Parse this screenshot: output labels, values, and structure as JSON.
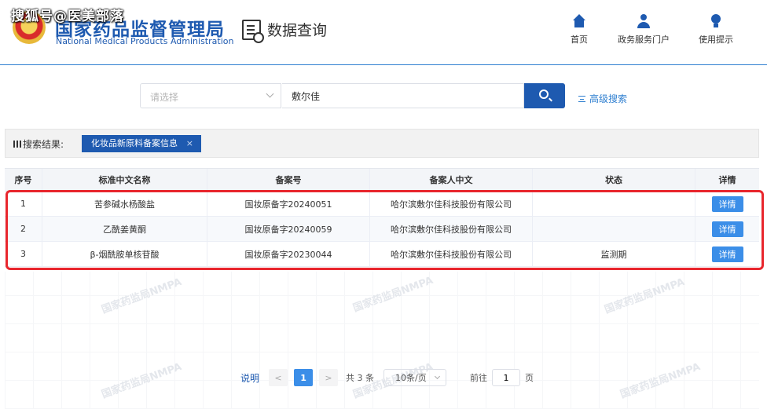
{
  "overlay_watermark": "搜狐号@医美部落",
  "header": {
    "org_name_cn": "国家药品监督管理局",
    "org_name_en": "National Medical Products Administration",
    "section_title": "数据查询",
    "nav": [
      {
        "label": "首页",
        "icon": "home-icon"
      },
      {
        "label": "政务服务门户",
        "icon": "user-icon"
      },
      {
        "label": "使用提示",
        "icon": "lightbulb-icon"
      }
    ]
  },
  "search": {
    "category_placeholder": "请选择",
    "query_value": "敷尔佳",
    "advanced_label": "高级搜索"
  },
  "results": {
    "label": "搜索结果:",
    "active_tag": "化妆品新原料备案信息",
    "close_glyph": "×"
  },
  "table": {
    "columns": [
      "序号",
      "标准中文名称",
      "备案号",
      "备案人中文",
      "状态",
      "详情"
    ],
    "rows": [
      {
        "no": "1",
        "name": "苦参碱水杨酸盐",
        "record": "国妆原备字20240051",
        "filer": "哈尔滨敷尔佳科技股份有限公司",
        "status": "",
        "action": "详情"
      },
      {
        "no": "2",
        "name": "乙酰姜黄酮",
        "record": "国妆原备字20240059",
        "filer": "哈尔滨敷尔佳科技股份有限公司",
        "status": "",
        "action": "详情"
      },
      {
        "no": "3",
        "name": "β-烟酰胺单核苷酸",
        "record": "国妆原备字20230044",
        "filer": "哈尔滨敷尔佳科技股份有限公司",
        "status": "监测期",
        "action": "详情"
      }
    ]
  },
  "background_watermark": "国家药监局NMPA",
  "pagination": {
    "note": "说明",
    "prev": "<",
    "current": "1",
    "next": ">",
    "total": "共 3 条",
    "page_size": "10条/页",
    "goto_label": "前往",
    "goto_value": "1",
    "page_unit": "页"
  },
  "colors": {
    "brand": "#1e5ab0",
    "button": "#3b8ee8",
    "highlight": "#e8262d"
  }
}
